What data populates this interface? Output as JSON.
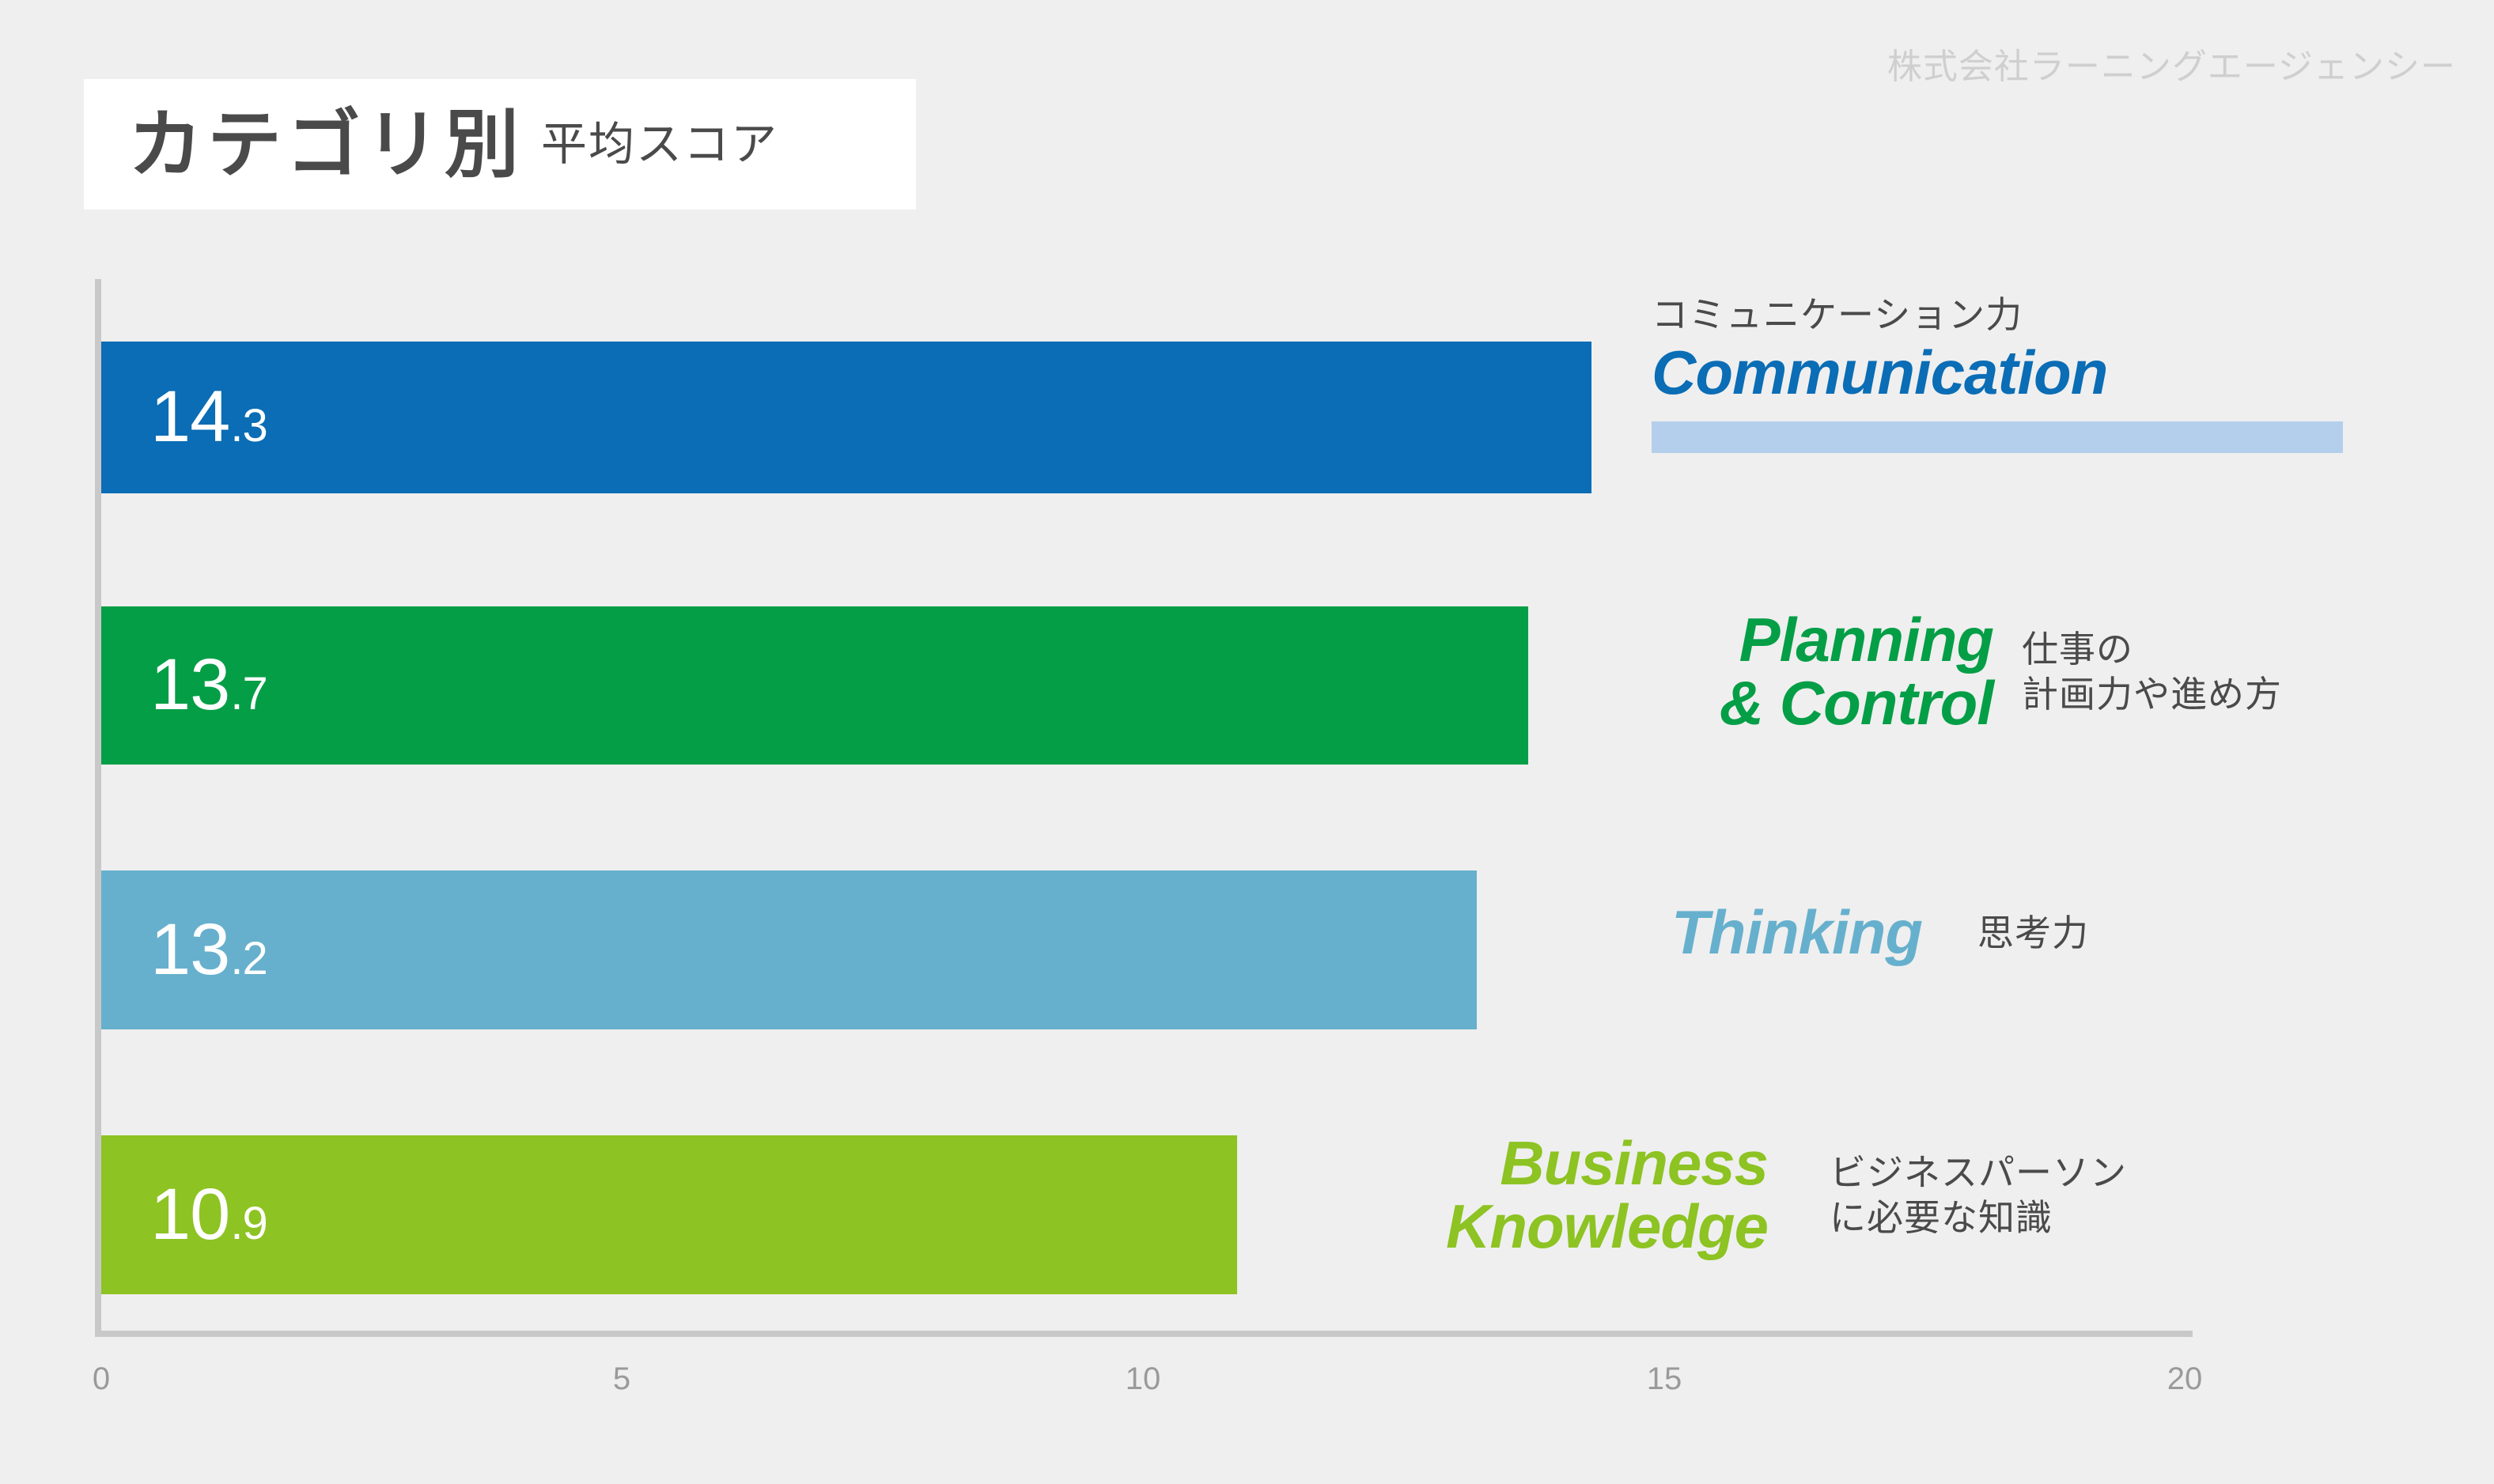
{
  "watermark": "株式会社ラーニングエージェンシー",
  "title": {
    "main": "カテゴリ別",
    "sub": "平均スコア"
  },
  "colors": {
    "background": "#efefef",
    "title_box": "#ffffff",
    "title_text": "#4a4a4a",
    "watermark": "#cfcfcf",
    "axis": "#c8c8c8",
    "tick_text": "#9a9a9a",
    "highlight_band": "#b4cfeb"
  },
  "chart_data": {
    "type": "bar",
    "orientation": "horizontal",
    "title": "カテゴリ別 平均スコア",
    "xlabel": "",
    "ylabel": "",
    "xlim": [
      0,
      20
    ],
    "xticks": [
      "0",
      "5",
      "10",
      "15",
      "20"
    ],
    "grid": false,
    "legend": "none",
    "categories": [
      "Communication",
      "Planning & Control",
      "Thinking",
      "Business Knowledge"
    ],
    "values": [
      14.3,
      13.7,
      13.2,
      10.9
    ],
    "bars": [
      {
        "value": 14.3,
        "value_int": "14",
        "value_dec": ".3",
        "color": "#0a6db5",
        "label_en": "Communication",
        "label_jp": "コミュニケーション力",
        "label_layout": "jp-above",
        "highlight": true
      },
      {
        "value": 13.7,
        "value_int": "13",
        "value_dec": ".7",
        "color": "#049e46",
        "label_en": "Planning\n& Control",
        "label_jp": "仕事の\n計画力や進め方",
        "label_layout": "jp-right",
        "highlight": false
      },
      {
        "value": 13.2,
        "value_int": "13",
        "value_dec": ".2",
        "color": "#66b0cd",
        "label_en": "Thinking",
        "label_jp": "思考力",
        "label_layout": "jp-right",
        "highlight": false
      },
      {
        "value": 10.9,
        "value_int": "10",
        "value_dec": ".9",
        "color": "#8dc322",
        "label_en": "Business\nKnowledge",
        "label_jp": "ビジネスパーソン\nに必要な知識",
        "label_layout": "jp-right",
        "highlight": false
      }
    ]
  }
}
